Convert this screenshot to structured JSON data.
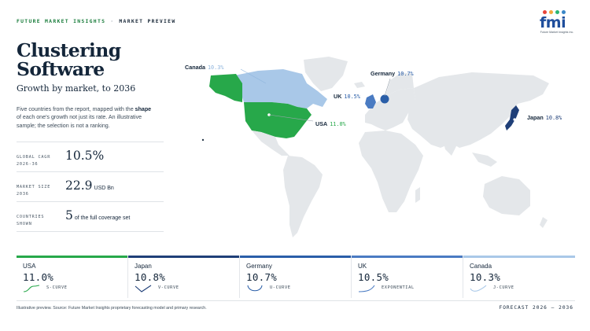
{
  "header": {
    "brand": "FUTURE MARKET INSIGHTS",
    "separator": "·",
    "section": "MARKET PREVIEW"
  },
  "logo": {
    "word": "fmi",
    "tagline": "Future Market Insights Inc.",
    "dot_colors": [
      "#e8443a",
      "#f2a93b",
      "#2bb673",
      "#3a86c8"
    ]
  },
  "title_lines": [
    "Clustering",
    "Software"
  ],
  "subtitle": "Growth by market, to 2036",
  "description": {
    "before": "Five countries from the report, mapped with the ",
    "bold": "shape",
    "after": " of each one's growth not just its rate. An illustrative sample; the selection is not a ranking."
  },
  "stats": [
    {
      "label_lines": [
        "GLOBAL CAGR",
        "2026-36"
      ],
      "value": "10.5%",
      "unit": ""
    },
    {
      "label_lines": [
        "MARKET SIZE",
        "2036"
      ],
      "value": "22.9",
      "unit": "USD Bn"
    },
    {
      "label_lines": [
        "COUNTRIES",
        "SHOWN"
      ],
      "value": "5",
      "unit": "of the full coverage set"
    }
  ],
  "map_labels": [
    {
      "country": "Canada",
      "value": "10.3%",
      "color": "#8fb5dd"
    },
    {
      "country": "Germany",
      "value": "10.7%",
      "color": "#2a5ea8"
    },
    {
      "country": "UK",
      "value": "10.5%",
      "color": "#2a5ea8"
    },
    {
      "country": "USA",
      "value": "11.0%",
      "color": "#27a84a"
    },
    {
      "country": "Japan",
      "value": "10.8%",
      "color": "#1f3f78"
    }
  ],
  "map_colors": {
    "land": "#e4e7ea",
    "usa": "#27a84a",
    "canada": "#a9c8e8",
    "uk": "#4a7bc2",
    "germany": "#2a5ea8",
    "japan": "#1f3f78"
  },
  "cards": [
    {
      "country": "USA",
      "value": "11.0%",
      "shape": "S-CURVE",
      "accent": "#27a84a"
    },
    {
      "country": "Japan",
      "value": "10.8%",
      "shape": "V-CURVE",
      "accent": "#1f3f78"
    },
    {
      "country": "Germany",
      "value": "10.7%",
      "shape": "U-CURVE",
      "accent": "#2a5ea8"
    },
    {
      "country": "UK",
      "value": "10.5%",
      "shape": "EXPONENTIAL",
      "accent": "#4a7bc2"
    },
    {
      "country": "Canada",
      "value": "10.3%",
      "shape": "J-CURVE",
      "accent": "#a9c8e8"
    }
  ],
  "footer": {
    "source": "Illustrative preview. Source: Future Market Insights proprietary forecasting model and primary research.",
    "forecast": "FORECAST 2026 – 2036"
  }
}
